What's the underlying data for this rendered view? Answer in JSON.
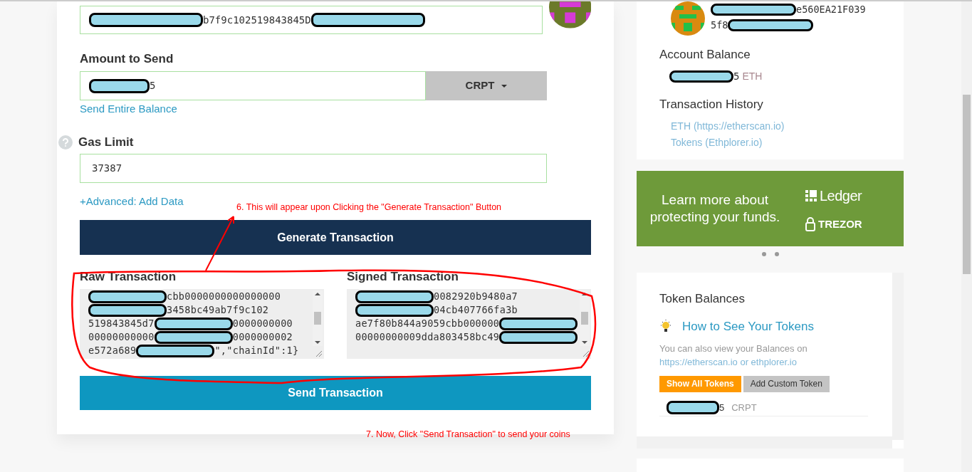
{
  "send_form": {
    "address_field": {
      "parts": [
        {
          "kind": "redacted"
        },
        {
          "kind": "text",
          "text": "b7f9c102519843845D"
        },
        {
          "kind": "redacted"
        }
      ]
    },
    "amount_label": "Amount to Send",
    "amount_field": {
      "parts": [
        {
          "kind": "redacted"
        },
        {
          "kind": "text",
          "text": "5"
        }
      ]
    },
    "unit_dropdown": "CRPT",
    "send_entire_balance": "Send Entire Balance",
    "gas_label": "Gas Limit",
    "gas_field": "37387",
    "advanced_link": "+Advanced: Add Data",
    "generate_button": "Generate Transaction",
    "raw": {
      "label": "Raw Transaction",
      "lines": [
        {
          "parts": [
            {
              "kind": "redacted"
            },
            {
              "kind": "text",
              "text": "cbb0000000000000000"
            }
          ]
        },
        {
          "parts": [
            {
              "kind": "redacted"
            },
            {
              "kind": "text",
              "text": "3458bc49ab7f9c102"
            }
          ]
        },
        {
          "parts": [
            {
              "kind": "text",
              "text": "519843845d7"
            },
            {
              "kind": "redacted"
            },
            {
              "kind": "text",
              "text": "0000000000"
            }
          ]
        },
        {
          "parts": [
            {
              "kind": "text",
              "text": "00000000000"
            },
            {
              "kind": "redacted"
            },
            {
              "kind": "text",
              "text": "0000000002"
            }
          ]
        },
        {
          "parts": [
            {
              "kind": "text",
              "text": "e572a689"
            },
            {
              "kind": "redacted"
            },
            {
              "kind": "text",
              "text": "\",\"chainId\":1}"
            }
          ]
        }
      ]
    },
    "signed": {
      "label": "Signed Transaction",
      "lines": [
        {
          "parts": [
            {
              "kind": "redacted"
            },
            {
              "kind": "text",
              "text": "0082920b9480a7"
            }
          ]
        },
        {
          "parts": [
            {
              "kind": "redacted"
            },
            {
              "kind": "text",
              "text": "04cb407766fa3b"
            }
          ]
        },
        {
          "parts": [
            {
              "kind": "text",
              "text": "ae7f80b844a9059cbb000000"
            },
            {
              "kind": "redacted"
            }
          ]
        },
        {
          "parts": [
            {
              "kind": "text",
              "text": "00000000009dda803458bc49"
            },
            {
              "kind": "redacted"
            }
          ]
        }
      ]
    },
    "send_button": "Send Transaction"
  },
  "annotations": [
    {
      "kind": "step",
      "text": "6. This will appear upon Clicking the \"Generate Transaction\" Button"
    },
    {
      "kind": "step",
      "text": "7. Now, Click \"Send Transaction\" to send your coins"
    }
  ],
  "sidebar": {
    "address": [
      {
        "parts": [
          {
            "kind": "redacted"
          },
          {
            "kind": "text",
            "text": "e560EA21F039"
          }
        ]
      },
      {
        "parts": [
          {
            "kind": "text",
            "text": "5f8"
          },
          {
            "kind": "redacted"
          }
        ]
      }
    ],
    "balance_title": "Account Balance",
    "balance": {
      "parts": [
        {
          "kind": "redacted"
        },
        {
          "kind": "text",
          "text": "5"
        }
      ],
      "unit": "ETH"
    },
    "history_title": "Transaction History",
    "history_links": [
      "ETH (https://etherscan.io)",
      "Tokens (Ethplorer.io)"
    ],
    "banner": {
      "text": "Learn more about protecting your funds.",
      "brands": [
        "Ledger",
        "TREZOR"
      ]
    },
    "carousel_dots": [
      {
        "selected": false
      },
      {
        "selected": false
      }
    ],
    "tokens": {
      "title": "Token Balances",
      "help_link": "How to See Your Tokens",
      "note": "You can also view your Balances on",
      "note_links": "https://etherscan.io or ethplorer.io",
      "show_all_button": "Show All Tokens",
      "add_custom_button": "Add Custom Token",
      "rows": [
        {
          "parts": [
            {
              "kind": "redacted"
            },
            {
              "kind": "text",
              "text": "5"
            }
          ],
          "symbol": "CRPT"
        }
      ]
    }
  }
}
